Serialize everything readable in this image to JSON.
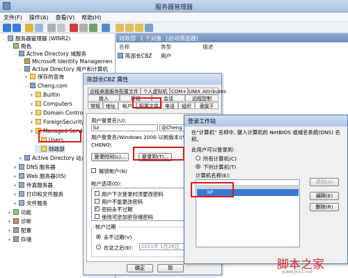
{
  "window": {
    "title": "服务器管理器"
  },
  "menu": [
    "文件(F)",
    "操作(A)",
    "查看(V)",
    "帮助(H)"
  ],
  "tree": [
    {
      "label": "服务器管理器 (WINR2)",
      "expand": "-"
    },
    {
      "label": "角色",
      "expand": "-"
    },
    {
      "label": "Active Directory 域服务",
      "expand": "-"
    },
    {
      "label": "Microsoft Identity Managemen",
      "expand": ""
    },
    {
      "label": "Active Directory 用户和计算机",
      "expand": "-"
    },
    {
      "label": "保存的查询",
      "expand": "+"
    },
    {
      "label": "Cheng.com",
      "expand": "-"
    },
    {
      "label": "Builtin",
      "expand": "+"
    },
    {
      "label": "Computers",
      "expand": "+"
    },
    {
      "label": "Domain Controllers",
      "expand": "+"
    },
    {
      "label": "ForeignSecurityPrincipals",
      "expand": "+"
    },
    {
      "label": "Managed Service Accounts",
      "expand": "+"
    },
    {
      "label": "Users",
      "expand": ""
    },
    {
      "label": "财政部",
      "expand": ""
    },
    {
      "label": "Active Directory 站点和服务",
      "expand": "+"
    },
    {
      "label": "DNS 服务器",
      "expand": "+"
    },
    {
      "label": "Web 服务器(IIS)",
      "expand": "+"
    },
    {
      "label": "传真服务器",
      "expand": "+"
    },
    {
      "label": "打印和文件服务",
      "expand": "+"
    },
    {
      "label": "文件服务",
      "expand": "+"
    },
    {
      "label": "功能",
      "expand": "+"
    },
    {
      "label": "诊断",
      "expand": "+"
    },
    {
      "label": "配置",
      "expand": "+"
    },
    {
      "label": "存储",
      "expand": "+"
    }
  ],
  "right": {
    "header": [
      "财政部",
      "1 个对象",
      "[启动筛选器]"
    ],
    "columns": [
      "名称",
      "类型",
      "描述"
    ],
    "row": {
      "name": "陈部长CBZ",
      "type": "用户",
      "desc": ""
    }
  },
  "props": {
    "title": "陈部长CBZ 属性",
    "tabs_row1": [
      "远程桌面服务配置文件",
      "个人虚拟机",
      "COM+",
      "UNIX Attributes"
    ],
    "tabs_row2": [
      "拨入",
      "环境",
      "会话",
      "远程控制"
    ],
    "tabs_row3": [
      "常规",
      "地址",
      "帐户",
      "配置文件",
      "电话",
      "组织",
      "隶属于"
    ],
    "logon_label": "用户登录名(U):",
    "logon_value": "bz",
    "logon_suffix": "@Cheng",
    "pre2000_label": "用户登录名(Windows 2000 以前版本)(W):",
    "pre2000_value": "CHENG\\",
    "btn_logon_hours": "登录时间(L)...",
    "btn_logon_to": "登录到(T)...",
    "unlock": "解锁帐户(N)",
    "account_options": "帐户选项(O):",
    "options": [
      {
        "label": "用户下次登录时须更改密码",
        "checked": false
      },
      {
        "label": "用户不能更改密码",
        "checked": false
      },
      {
        "label": "密码永不过期",
        "checked": true
      },
      {
        "label": "使用可逆加密存储密码",
        "checked": false
      }
    ],
    "expiry_label": "帐户过期",
    "never": "永不过期(V)",
    "end_of": "在这之后(E):",
    "end_date": "2011年  1月26日",
    "ok": "确定",
    "cancel": "取"
  },
  "logon_dialog": {
    "title": "登录工作站",
    "desc": "在\"计算机\" 名称中, 键入计算机的 NetBIOS 或域名系统(DNS) 名称。",
    "can_logon": "此用户可以登录到:",
    "all_computers": "所有计算机(C)",
    "these_computers": "下列计算机(T)",
    "computer_name": "计算机名称(E):",
    "add": "添加(A)",
    "edit": "编辑(E)",
    "remove": "删除(R)",
    "selected_item": "XP"
  },
  "watermark": {
    "text": "脚本之家",
    "sub": "www.jb51.net"
  }
}
